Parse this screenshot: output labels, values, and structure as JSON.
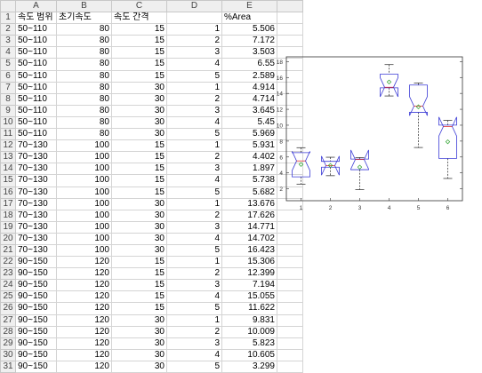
{
  "sheet": {
    "columns": [
      "A",
      "B",
      "C",
      "D",
      "E"
    ],
    "header": [
      "속도 범위",
      "초기속도",
      "속도 간격",
      "",
      "%Area"
    ],
    "rows": [
      [
        "50~110",
        "80",
        "15",
        "1",
        "5.506"
      ],
      [
        "50~110",
        "80",
        "15",
        "2",
        "7.172"
      ],
      [
        "50~110",
        "80",
        "15",
        "3",
        "3.503"
      ],
      [
        "50~110",
        "80",
        "15",
        "4",
        "6.55"
      ],
      [
        "50~110",
        "80",
        "15",
        "5",
        "2.589"
      ],
      [
        "50~110",
        "80",
        "30",
        "1",
        "4.914"
      ],
      [
        "50~110",
        "80",
        "30",
        "2",
        "4.714"
      ],
      [
        "50~110",
        "80",
        "30",
        "3",
        "3.645"
      ],
      [
        "50~110",
        "80",
        "30",
        "4",
        "5.45"
      ],
      [
        "50~110",
        "80",
        "30",
        "5",
        "5.969"
      ],
      [
        "70~130",
        "100",
        "15",
        "1",
        "5.931"
      ],
      [
        "70~130",
        "100",
        "15",
        "2",
        "4.402"
      ],
      [
        "70~130",
        "100",
        "15",
        "3",
        "1.897"
      ],
      [
        "70~130",
        "100",
        "15",
        "4",
        "5.738"
      ],
      [
        "70~130",
        "100",
        "15",
        "5",
        "5.682"
      ],
      [
        "70~130",
        "100",
        "30",
        "1",
        "13.676"
      ],
      [
        "70~130",
        "100",
        "30",
        "2",
        "17.626"
      ],
      [
        "70~130",
        "100",
        "30",
        "3",
        "14.771"
      ],
      [
        "70~130",
        "100",
        "30",
        "4",
        "14.702"
      ],
      [
        "70~130",
        "100",
        "30",
        "5",
        "16.423"
      ],
      [
        "90~150",
        "120",
        "15",
        "1",
        "15.306"
      ],
      [
        "90~150",
        "120",
        "15",
        "2",
        "12.399"
      ],
      [
        "90~150",
        "120",
        "15",
        "3",
        "7.194"
      ],
      [
        "90~150",
        "120",
        "15",
        "4",
        "15.055"
      ],
      [
        "90~150",
        "120",
        "15",
        "5",
        "11.622"
      ],
      [
        "90~150",
        "120",
        "30",
        "1",
        "9.831"
      ],
      [
        "90~150",
        "120",
        "30",
        "2",
        "10.009"
      ],
      [
        "90~150",
        "120",
        "30",
        "3",
        "5.823"
      ],
      [
        "90~150",
        "120",
        "30",
        "4",
        "10.605"
      ],
      [
        "90~150",
        "120",
        "30",
        "5",
        "3.299"
      ]
    ]
  },
  "chart_data": {
    "type": "boxplot",
    "categories": [
      "1",
      "2",
      "3",
      "4",
      "5",
      "6"
    ],
    "yticks": [
      2,
      4,
      6,
      8,
      10,
      12,
      14,
      16,
      18
    ],
    "ylim": [
      0.5,
      18.6
    ],
    "groups": [
      {
        "min": 2.589,
        "q1": 3.503,
        "median": 5.506,
        "q3": 6.55,
        "max": 7.172,
        "mean": 5.064
      },
      {
        "min": 3.645,
        "q1": 4.714,
        "median": 4.914,
        "q3": 5.45,
        "max": 5.969,
        "mean": 4.938
      },
      {
        "min": 1.897,
        "q1": 4.402,
        "median": 5.682,
        "q3": 5.738,
        "max": 5.931,
        "mean": 4.73
      },
      {
        "min": 13.676,
        "q1": 14.702,
        "median": 14.771,
        "q3": 16.423,
        "max": 17.626,
        "mean": 15.44
      },
      {
        "min": 7.194,
        "q1": 11.622,
        "median": 12.399,
        "q3": 15.055,
        "max": 15.306,
        "mean": 12.315
      },
      {
        "min": 3.299,
        "q1": 5.823,
        "median": 9.831,
        "q3": 10.009,
        "max": 10.605,
        "mean": 7.913
      }
    ],
    "colors": {
      "box": "#3b3bd6",
      "median": "#e03030",
      "mean": "#2aa12a",
      "whisker": "#222222"
    }
  }
}
